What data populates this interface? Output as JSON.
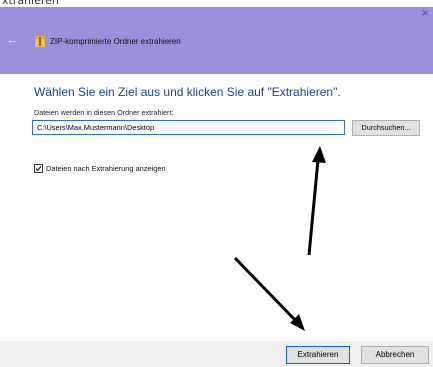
{
  "top_caption": "xtrahieren",
  "window": {
    "title": "ZIP-komprimierte Ordner extrahieren",
    "close_icon": "close-icon",
    "back_icon": "back-arrow-icon",
    "folder_icon": "zip-folder-icon",
    "titlebar_color": "#9a90dc"
  },
  "main": {
    "heading": "Wählen Sie ein Ziel aus und klicken Sie auf \"Extrahieren\".",
    "field_label": "Dateien werden in diesen Ordner extrahiert:",
    "path_value": "C:\\Users\\Max.Mustermann\\Desktop",
    "browse_label": "Durchsuchen...",
    "checkbox_label": "Dateien nach Extrahierung anzeigen",
    "checkbox_checked": true
  },
  "footer": {
    "extract_label": "Extrahieren",
    "cancel_label": "Abbrechen"
  },
  "annotations": {
    "arrow_color": "#000000",
    "arrow_icons": [
      "arrow-up-icon",
      "arrow-down-right-icon"
    ]
  }
}
